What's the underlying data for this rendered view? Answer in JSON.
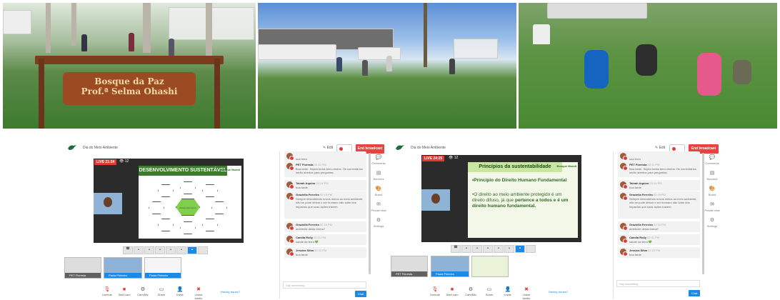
{
  "photos": {
    "sign_line1": "Bosque da Paz",
    "sign_line2": "Prof.ª Selma Ohashi"
  },
  "broadcasts": [
    {
      "title": "Dia do Meio Ambiente",
      "edit_label": "Edit",
      "end_label": "End broadcast",
      "live_label": "LIVE 21:24",
      "views": "12",
      "slide_title": "DESENVOLVIMENTO SUSTENTÁVEL",
      "brand": "Bosque Mundi",
      "hex_center": "Desenvolvimento sustentável",
      "thumbs": [
        "PET Floresta",
        "Paula Pinheiro",
        "Paula Pinheiro"
      ],
      "bottom": [
        "Unmute",
        "Start cam",
        "Cam/Mic",
        "Share",
        "Invite",
        "Leave studio"
      ],
      "help": "Having issues?",
      "chat": [
        {
          "name": "",
          "time": "",
          "text": "sua terra"
        },
        {
          "name": "PET Floresta",
          "time": "02:11 PM",
          "text": "Boa tarde. Sejam todos bem-vindos. Os comentários serão abertos para perguntas."
        },
        {
          "name": "Tainah Aquino",
          "time": "02:14 PM",
          "text": "boa tarde"
        },
        {
          "name": "Graziella Ferreira",
          "time": "02:15 PM",
          "text": "Sempre descobrindo novos meios ao meio ambiente, não se pode deixar o ser humano não sabe dos impactos que suas ações trazem."
        },
        {
          "name": "Graziella Ferreira",
          "time": "02:18 PM",
          "text": "ambiente desta forma?"
        },
        {
          "name": "Camila Rolly",
          "time": "02:21 PM",
          "text": "saúde da terra 💚"
        },
        {
          "name": "Jessica Silva",
          "time": "02:22 PM",
          "text": "boa tarde"
        }
      ],
      "chat_placeholder": "Say something",
      "chat_send": "Chat",
      "side": [
        "Comments",
        "Banners",
        "Brand",
        "Private chat",
        "Settings"
      ]
    },
    {
      "title": "Dia do Meio Ambiente",
      "edit_label": "Edit",
      "end_label": "End broadcast",
      "live_label": "LIVE 24:25",
      "views": "12",
      "slide_title": "Princípios da sustentabilidade",
      "bullet1": "Princípio do Direito Humano Fundamental",
      "bullet2a": "O direito ao meio ambiente protegido é um direito difuso, já que ",
      "bullet2b": "pertence a todos e é um direito humano fundamental.",
      "brand": "Bosque Mundi",
      "thumbs": [
        "PET Floresta",
        "Paula Pinheiro",
        ""
      ],
      "bottom": [
        "Unmute",
        "Start cam",
        "Cam/Mic",
        "Share",
        "Invite",
        "Leave studio"
      ],
      "help": "Having issues?",
      "chat": [
        {
          "name": "",
          "time": "",
          "text": "sua terra"
        },
        {
          "name": "PET Floresta",
          "time": "02:11 PM",
          "text": "Boa tarde. Sejam todos bem-vindos. Os comentários serão abertos para perguntas."
        },
        {
          "name": "Tainah Aquino",
          "time": "02:14 PM",
          "text": "boa tarde"
        },
        {
          "name": "Graziella Ferreira",
          "time": "02:15 PM",
          "text": "Sempre descobrindo novos meios ao meio ambiente, não se pode deixar o ser humano não sabe dos impactos que suas ações trazem."
        },
        {
          "name": "Graziella Ferreira",
          "time": "02:18 PM",
          "text": "ambiente desta forma?"
        },
        {
          "name": "Camila Rolly",
          "time": "02:21 PM",
          "text": "saúde da terra 💚"
        },
        {
          "name": "Jessica Silva",
          "time": "02:22 PM",
          "text": "boa tarde"
        }
      ],
      "chat_placeholder": "Say something",
      "chat_send": "Chat",
      "side": [
        "Comments",
        "Banners",
        "Brand",
        "Private chat",
        "Settings"
      ]
    }
  ]
}
